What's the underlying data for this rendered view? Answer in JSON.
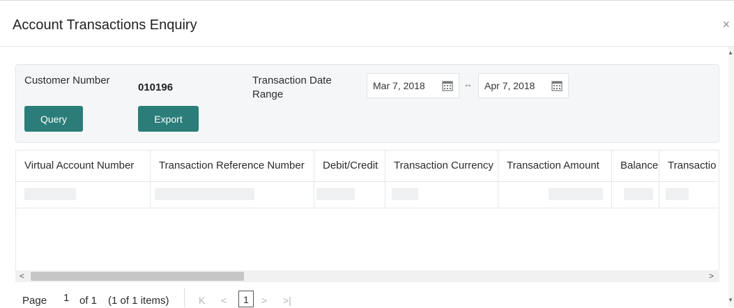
{
  "dialog": {
    "title": "Account Transactions Enquiry",
    "close_glyph": "×"
  },
  "form": {
    "customer_label": "Customer Number",
    "customer_value": "010196",
    "date_range_label_1": "Transaction Date",
    "date_range_label_2": "Range",
    "date_from": "Mar 7, 2018",
    "date_to": "Apr 7, 2018",
    "range_arrow": "↔",
    "query_label": "Query",
    "export_label": "Export",
    "accent_color": "#2a7d78"
  },
  "table": {
    "columns": [
      "Virtual Account Number",
      "Transaction Reference Number",
      "Debit/Credit",
      "Transaction Currency",
      "Transaction Amount",
      "Balance",
      "Transactio"
    ]
  },
  "pager": {
    "page_label": "Page",
    "page_value": "1",
    "of_label": "of 1",
    "items_label": "(1 of 1 items)",
    "first": "K",
    "prev": "<",
    "current": "1",
    "next": ">",
    "last": ">|"
  },
  "scroll": {
    "left": "<",
    "right": ">"
  }
}
